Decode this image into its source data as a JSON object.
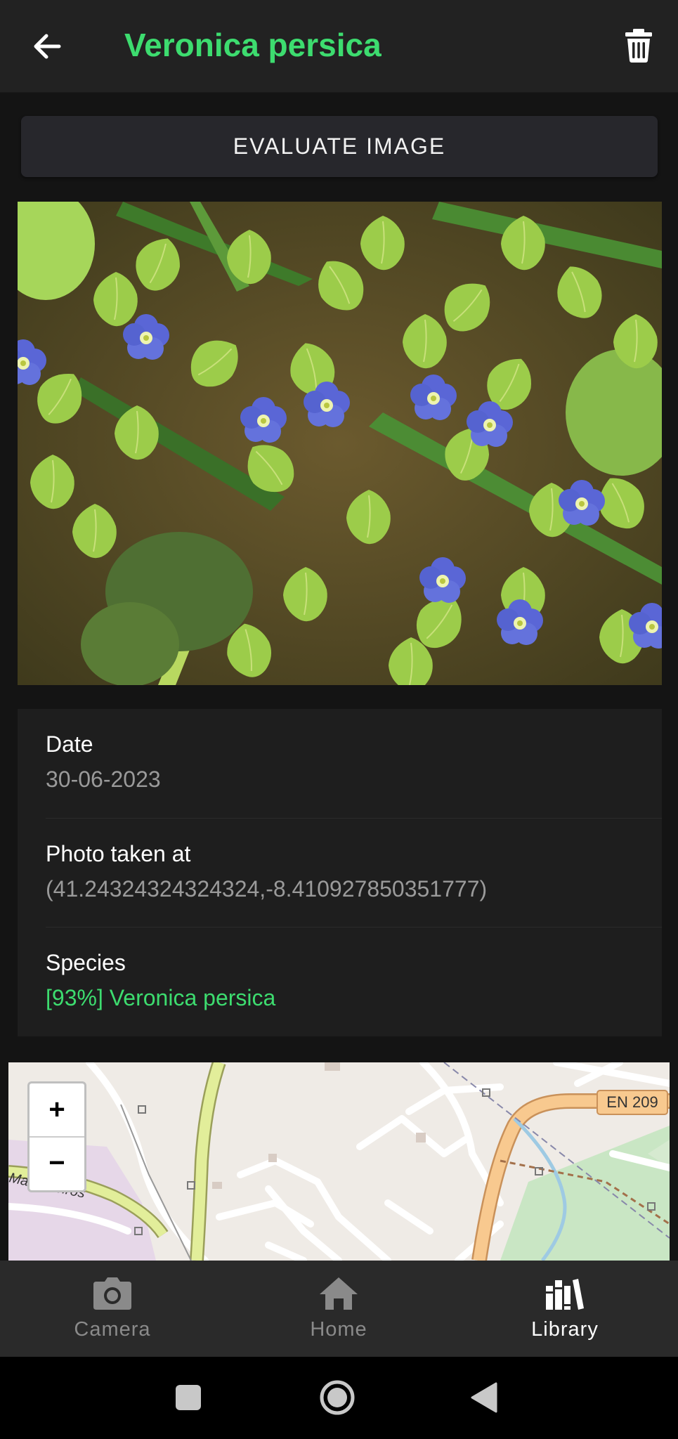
{
  "app_bar": {
    "title": "Veronica persica",
    "back_icon": "arrow-left-icon",
    "delete_icon": "trash-icon"
  },
  "actions": {
    "evaluate_label": "EVALUATE IMAGE"
  },
  "details": {
    "date_label": "Date",
    "date_value": "30-06-2023",
    "location_label": "Photo taken at",
    "location_value": "(41.24324324324324,-8.410927850351777)",
    "species_label": "Species",
    "species_value": "[93%] Veronica persica"
  },
  "map": {
    "zoom_in_label": "+",
    "zoom_out_label": "−",
    "road_label": "EN 209",
    "place_label": "Marceneiros"
  },
  "bottom_nav": {
    "items": [
      {
        "label": "Camera",
        "icon": "camera-icon",
        "active": false
      },
      {
        "label": "Home",
        "icon": "home-icon",
        "active": false
      },
      {
        "label": "Library",
        "icon": "library-icon",
        "active": true
      }
    ]
  },
  "colors": {
    "accent": "#3ddc6f",
    "background": "#141414",
    "card": "#1e1e1e",
    "appbar": "#222222"
  }
}
